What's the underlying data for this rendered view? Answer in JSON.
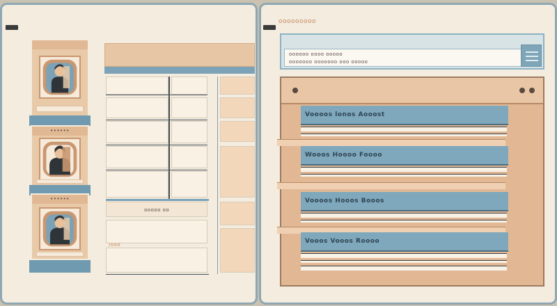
{
  "left_panel": {
    "thumbnails": [
      {
        "header": "",
        "caption": ""
      },
      {
        "header": "••••••",
        "caption": ""
      },
      {
        "header": "••••••",
        "caption": ""
      }
    ],
    "table": {
      "footer_label": "ooooo oo",
      "side_label": "/ooo"
    }
  },
  "right_panel": {
    "title": "ooooooooo",
    "search": {
      "line1": "oooooo oooo ooooo",
      "line2": "ooooooo ooooooo ooo ooooo"
    },
    "list_items": [
      {
        "title": "Voooos  lonos  Aooost"
      },
      {
        "title": "Wooos  Hoooo  Foooo"
      },
      {
        "title": "Voooos  Hooos  Booos"
      },
      {
        "title": "Vooos  Vooos  Roooo"
      }
    ]
  },
  "colors": {
    "accent_blue": "#7fa8bd",
    "peach": "#e2b894",
    "cream": "#f3ecdf",
    "border_blue": "#8fa7b2"
  },
  "icons": {
    "left_menu": "menu-icon",
    "right_menu": "menu-icon",
    "portrait": "portrait-icon",
    "search_button": "hamburger-icon"
  }
}
